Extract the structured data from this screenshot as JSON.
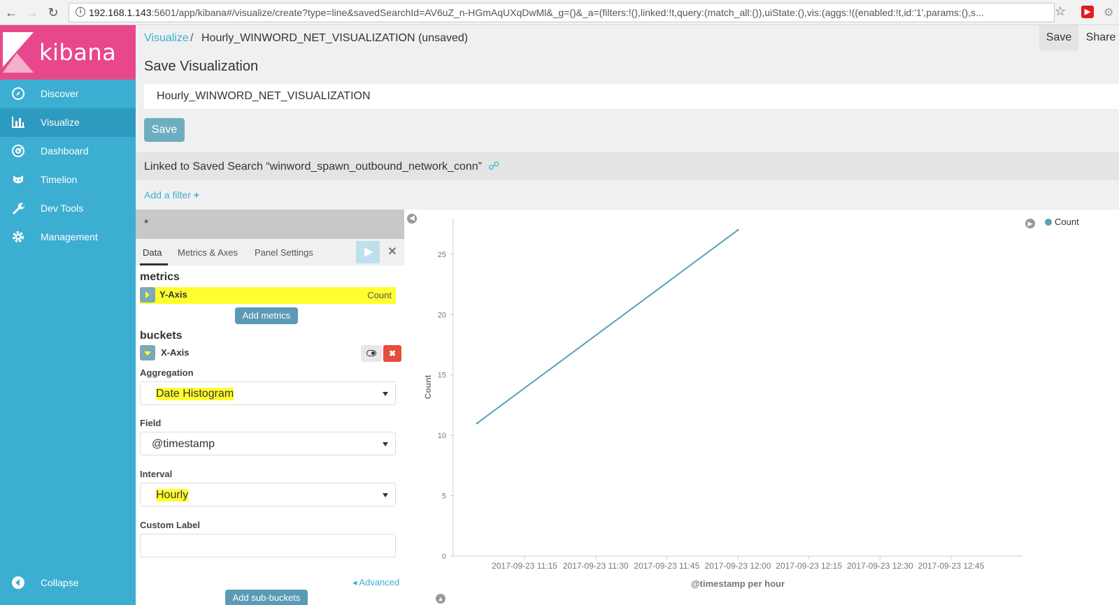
{
  "browser": {
    "url_host": "192.168.1.143",
    "url_rest": ":5601/app/kibana#/visualize/create?type=line&savedSearchId=AV6uZ_n-HGmAqUXqDwMl&_g=()&_a=(filters:!(),linked:!t,query:(match_all:()),uiState:(),vis:(aggs:!((enabled:!t,id:'1',params:(),s..."
  },
  "sidebar": {
    "logo": "kibana",
    "items": [
      {
        "label": "Discover",
        "icon": "compass-icon"
      },
      {
        "label": "Visualize",
        "icon": "bar-chart-icon"
      },
      {
        "label": "Dashboard",
        "icon": "dashboard-icon"
      },
      {
        "label": "Timelion",
        "icon": "timelion-icon"
      },
      {
        "label": "Dev Tools",
        "icon": "wrench-icon"
      },
      {
        "label": "Management",
        "icon": "gear-icon"
      }
    ],
    "collapse": "Collapse"
  },
  "topbar": {
    "crumb_link": "Visualize",
    "crumb_sep": "/",
    "title": "Hourly_WINWORD_NET_VISUALIZATION (unsaved)",
    "save": "Save",
    "share": "Share"
  },
  "save_panel": {
    "heading": "Save Visualization",
    "input_value": "Hourly_WINWORD_NET_VISUALIZATION",
    "save_btn": "Save"
  },
  "linked": {
    "text": "Linked to Saved Search “winword_spawn_outbound_network_conn”"
  },
  "filter": {
    "add": "Add a filter",
    "plus": "+"
  },
  "editor": {
    "query": "*",
    "tabs": [
      "Data",
      "Metrics & Axes",
      "Panel Settings"
    ],
    "metrics_head": "metrics",
    "y_axis": "Y-Axis",
    "y_value": "Count",
    "add_metrics": "Add metrics",
    "buckets_head": "buckets",
    "x_axis": "X-Axis",
    "aggregation_label": "Aggregation",
    "aggregation_value": "Date Histogram",
    "field_label": "Field",
    "field_value": "@timestamp",
    "interval_label": "Interval",
    "interval_value": "Hourly",
    "custom_label": "Custom Label",
    "advanced": "Advanced",
    "add_sub_buckets": "Add sub-buckets"
  },
  "colors": {
    "sidebar": "#3caed2",
    "logo": "#e8488b",
    "line": "#57a2b8",
    "highlight": "#ffff30",
    "delete": "#e74c3c"
  },
  "chart_data": {
    "type": "line",
    "series": [
      {
        "name": "Count",
        "x": [
          "2017-09-23 11:05",
          "2017-09-23 12:00"
        ],
        "y": [
          11,
          27
        ]
      }
    ],
    "x_ticks": [
      "2017-09-23 11:15",
      "2017-09-23 11:30",
      "2017-09-23 11:45",
      "2017-09-23 12:00",
      "2017-09-23 12:15",
      "2017-09-23 12:30",
      "2017-09-23 12:45"
    ],
    "y_ticks": [
      0,
      5,
      10,
      15,
      20,
      25
    ],
    "ylim": [
      0,
      28
    ],
    "ylabel": "Count",
    "xlabel": "@timestamp per hour",
    "legend": "top-right"
  }
}
